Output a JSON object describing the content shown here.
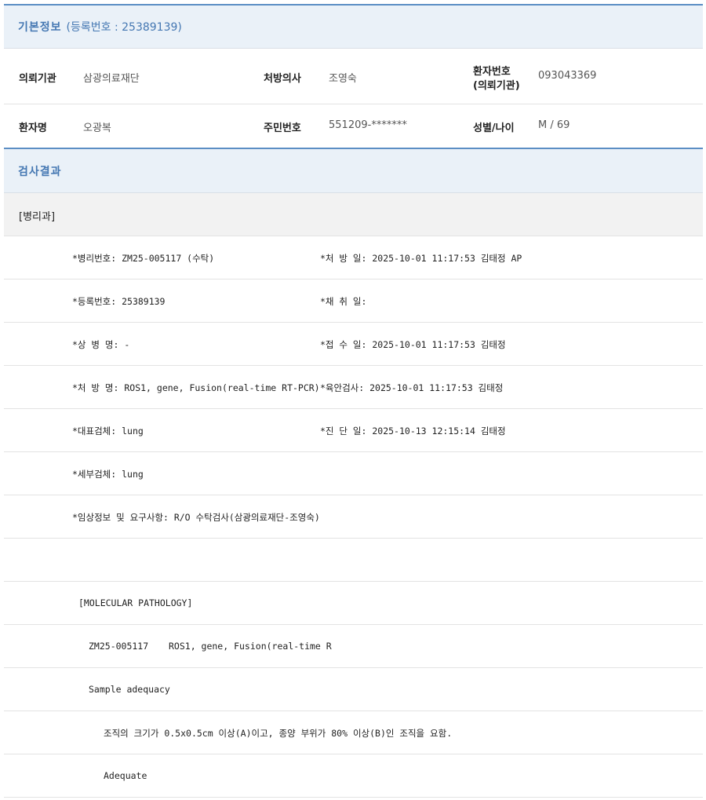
{
  "basic_info": {
    "title": "기본정보",
    "registration": "(등록번호 : 25389139)",
    "fields": {
      "institution_label": "의뢰기관",
      "institution_value": "삼광의료재단",
      "doctor_label": "처방의사",
      "doctor_value": "조영숙",
      "patient_no_label_1": "환자번호",
      "patient_no_label_2": "(의뢰기관)",
      "patient_no_value": "093043369",
      "patient_name_label": "환자명",
      "patient_name_value": "오광복",
      "resident_no_label": "주민번호",
      "resident_no_value": "551209-*******",
      "sex_age_label": "성별/나이",
      "sex_age_value": "M / 69"
    }
  },
  "results": {
    "title": "검사결과",
    "department": "[병리과]",
    "rows": [
      {
        "left": "*병리번호: ZM25-005117 (수탁)",
        "right": "*처 방 일: 2025-10-01 11:17:53  김태정 AP"
      },
      {
        "left": "*등록번호: 25389139",
        "right": "*채 취 일:"
      },
      {
        "left": "*상 병 명: -",
        "right": "*접 수 일: 2025-10-01 11:17:53  김태정"
      },
      {
        "left": "*처 방 명: ROS1, gene, Fusion(real-time RT-PCR)",
        "right": "*육안검사: 2025-10-01 11:17:53  김태정"
      },
      {
        "left": "*대표검체: lung",
        "right": "*진 단 일: 2025-10-13 12:15:14  김태정"
      },
      {
        "left": "*세부검체: lung",
        "right": ""
      },
      {
        "left": "*임상정보 및 요구사항: R/O 수탁검사(삼광의료재단-조영숙)",
        "right": ""
      },
      {
        "left": "",
        "right": ""
      }
    ],
    "molecular": {
      "header": "[MOLECULAR PATHOLOGY]",
      "case_no": "ZM25-005117",
      "test_name": "ROS1, gene, Fusion(real-time R",
      "adequacy_label": "Sample adequacy",
      "criteria": "조직의 크기가 0.5x0.5cm 이상(A)이고, 종양 부위가 80% 이상(B)인 조직을 요함.",
      "adequacy_value": "Adequate"
    }
  }
}
